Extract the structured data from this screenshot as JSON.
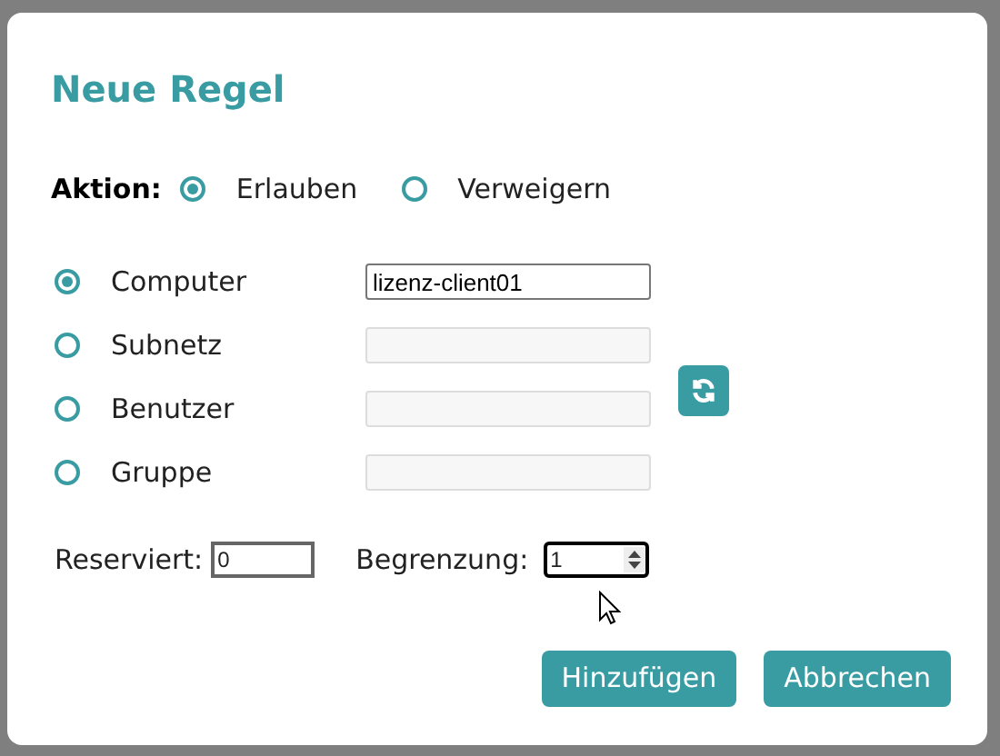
{
  "dialog": {
    "title": "Neue Regel"
  },
  "action": {
    "label": "Aktion:",
    "options": [
      {
        "label": "Erlauben",
        "selected": true
      },
      {
        "label": "Verweigern",
        "selected": false
      }
    ]
  },
  "targets": [
    {
      "label": "Computer",
      "selected": true,
      "value": "lizenz-client01"
    },
    {
      "label": "Subnetz",
      "selected": false
    },
    {
      "label": "Benutzer",
      "selected": false
    },
    {
      "label": "Gruppe",
      "selected": false
    }
  ],
  "reserved": {
    "label": "Reserviert:",
    "value": "0"
  },
  "limit": {
    "label": "Begrenzung:",
    "value": "1"
  },
  "buttons": [
    "Hinzufügen",
    "Abbrechen"
  ]
}
